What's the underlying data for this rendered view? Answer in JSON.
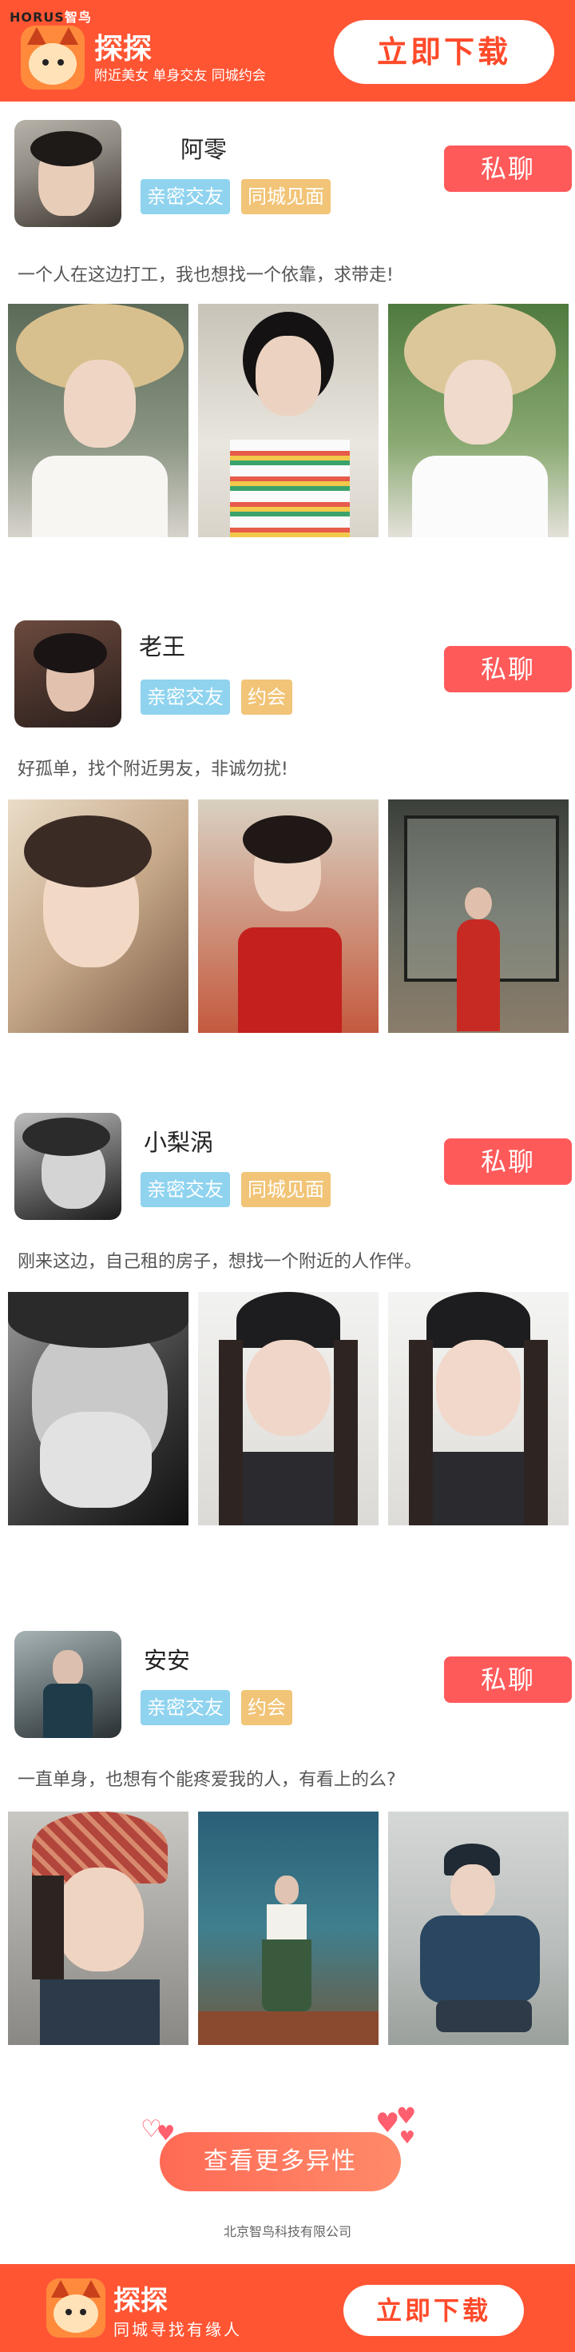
{
  "header": {
    "brand_left": "HORUS",
    "brand_right": "智鸟",
    "app_name": "探探",
    "tagline": "附近美女  单身交友  同城约会",
    "download_label": "立即下载"
  },
  "profiles": [
    {
      "name": "阿零",
      "tags": [
        "亲密交友",
        "同城见面"
      ],
      "chat_label": "私聊",
      "bio": "一个人在这边打工，我也想找一个依靠，求带走!"
    },
    {
      "name": "老王",
      "tags": [
        "亲密交友",
        "约会"
      ],
      "chat_label": "私聊",
      "bio": "好孤单，找个附近男友，非诚勿扰!"
    },
    {
      "name": "小梨涡",
      "tags": [
        "亲密交友",
        "同城见面"
      ],
      "chat_label": "私聊",
      "bio": "刚来这边，自己租的房子，想找一个附近的人作伴。"
    },
    {
      "name": "安安",
      "tags": [
        "亲密交友",
        "约会"
      ],
      "chat_label": "私聊",
      "bio": "一直单身，也想有个能疼爱我的人，有看上的么?"
    }
  ],
  "more_button": "查看更多异性",
  "company": "北京智鸟科技有限公司",
  "footer": {
    "app_name": "探探",
    "tagline": "同城寻找有缘人",
    "download_label": "立即下载"
  },
  "colors": {
    "brand": "#ff5533",
    "chat": "#ff5a5a",
    "tag_blue": "#8fd3ef",
    "tag_gold": "#f1c477"
  }
}
